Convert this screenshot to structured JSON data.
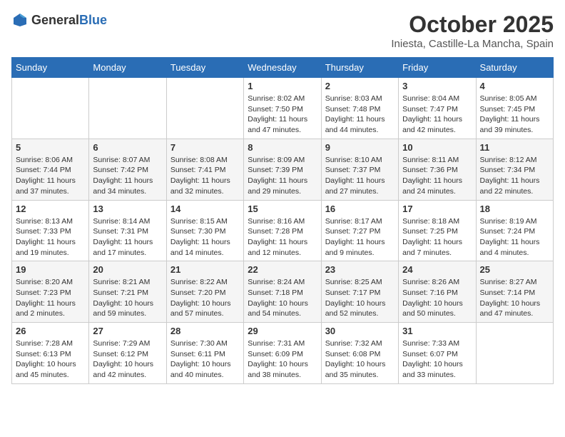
{
  "header": {
    "logo_general": "General",
    "logo_blue": "Blue",
    "month_title": "October 2025",
    "subtitle": "Iniesta, Castille-La Mancha, Spain"
  },
  "days_of_week": [
    "Sunday",
    "Monday",
    "Tuesday",
    "Wednesday",
    "Thursday",
    "Friday",
    "Saturday"
  ],
  "weeks": [
    [
      {
        "day": "",
        "sunrise": "",
        "sunset": "",
        "daylight": ""
      },
      {
        "day": "",
        "sunrise": "",
        "sunset": "",
        "daylight": ""
      },
      {
        "day": "",
        "sunrise": "",
        "sunset": "",
        "daylight": ""
      },
      {
        "day": "1",
        "sunrise": "Sunrise: 8:02 AM",
        "sunset": "Sunset: 7:50 PM",
        "daylight": "Daylight: 11 hours and 47 minutes."
      },
      {
        "day": "2",
        "sunrise": "Sunrise: 8:03 AM",
        "sunset": "Sunset: 7:48 PM",
        "daylight": "Daylight: 11 hours and 44 minutes."
      },
      {
        "day": "3",
        "sunrise": "Sunrise: 8:04 AM",
        "sunset": "Sunset: 7:47 PM",
        "daylight": "Daylight: 11 hours and 42 minutes."
      },
      {
        "day": "4",
        "sunrise": "Sunrise: 8:05 AM",
        "sunset": "Sunset: 7:45 PM",
        "daylight": "Daylight: 11 hours and 39 minutes."
      }
    ],
    [
      {
        "day": "5",
        "sunrise": "Sunrise: 8:06 AM",
        "sunset": "Sunset: 7:44 PM",
        "daylight": "Daylight: 11 hours and 37 minutes."
      },
      {
        "day": "6",
        "sunrise": "Sunrise: 8:07 AM",
        "sunset": "Sunset: 7:42 PM",
        "daylight": "Daylight: 11 hours and 34 minutes."
      },
      {
        "day": "7",
        "sunrise": "Sunrise: 8:08 AM",
        "sunset": "Sunset: 7:41 PM",
        "daylight": "Daylight: 11 hours and 32 minutes."
      },
      {
        "day": "8",
        "sunrise": "Sunrise: 8:09 AM",
        "sunset": "Sunset: 7:39 PM",
        "daylight": "Daylight: 11 hours and 29 minutes."
      },
      {
        "day": "9",
        "sunrise": "Sunrise: 8:10 AM",
        "sunset": "Sunset: 7:37 PM",
        "daylight": "Daylight: 11 hours and 27 minutes."
      },
      {
        "day": "10",
        "sunrise": "Sunrise: 8:11 AM",
        "sunset": "Sunset: 7:36 PM",
        "daylight": "Daylight: 11 hours and 24 minutes."
      },
      {
        "day": "11",
        "sunrise": "Sunrise: 8:12 AM",
        "sunset": "Sunset: 7:34 PM",
        "daylight": "Daylight: 11 hours and 22 minutes."
      }
    ],
    [
      {
        "day": "12",
        "sunrise": "Sunrise: 8:13 AM",
        "sunset": "Sunset: 7:33 PM",
        "daylight": "Daylight: 11 hours and 19 minutes."
      },
      {
        "day": "13",
        "sunrise": "Sunrise: 8:14 AM",
        "sunset": "Sunset: 7:31 PM",
        "daylight": "Daylight: 11 hours and 17 minutes."
      },
      {
        "day": "14",
        "sunrise": "Sunrise: 8:15 AM",
        "sunset": "Sunset: 7:30 PM",
        "daylight": "Daylight: 11 hours and 14 minutes."
      },
      {
        "day": "15",
        "sunrise": "Sunrise: 8:16 AM",
        "sunset": "Sunset: 7:28 PM",
        "daylight": "Daylight: 11 hours and 12 minutes."
      },
      {
        "day": "16",
        "sunrise": "Sunrise: 8:17 AM",
        "sunset": "Sunset: 7:27 PM",
        "daylight": "Daylight: 11 hours and 9 minutes."
      },
      {
        "day": "17",
        "sunrise": "Sunrise: 8:18 AM",
        "sunset": "Sunset: 7:25 PM",
        "daylight": "Daylight: 11 hours and 7 minutes."
      },
      {
        "day": "18",
        "sunrise": "Sunrise: 8:19 AM",
        "sunset": "Sunset: 7:24 PM",
        "daylight": "Daylight: 11 hours and 4 minutes."
      }
    ],
    [
      {
        "day": "19",
        "sunrise": "Sunrise: 8:20 AM",
        "sunset": "Sunset: 7:23 PM",
        "daylight": "Daylight: 11 hours and 2 minutes."
      },
      {
        "day": "20",
        "sunrise": "Sunrise: 8:21 AM",
        "sunset": "Sunset: 7:21 PM",
        "daylight": "Daylight: 10 hours and 59 minutes."
      },
      {
        "day": "21",
        "sunrise": "Sunrise: 8:22 AM",
        "sunset": "Sunset: 7:20 PM",
        "daylight": "Daylight: 10 hours and 57 minutes."
      },
      {
        "day": "22",
        "sunrise": "Sunrise: 8:24 AM",
        "sunset": "Sunset: 7:18 PM",
        "daylight": "Daylight: 10 hours and 54 minutes."
      },
      {
        "day": "23",
        "sunrise": "Sunrise: 8:25 AM",
        "sunset": "Sunset: 7:17 PM",
        "daylight": "Daylight: 10 hours and 52 minutes."
      },
      {
        "day": "24",
        "sunrise": "Sunrise: 8:26 AM",
        "sunset": "Sunset: 7:16 PM",
        "daylight": "Daylight: 10 hours and 50 minutes."
      },
      {
        "day": "25",
        "sunrise": "Sunrise: 8:27 AM",
        "sunset": "Sunset: 7:14 PM",
        "daylight": "Daylight: 10 hours and 47 minutes."
      }
    ],
    [
      {
        "day": "26",
        "sunrise": "Sunrise: 7:28 AM",
        "sunset": "Sunset: 6:13 PM",
        "daylight": "Daylight: 10 hours and 45 minutes."
      },
      {
        "day": "27",
        "sunrise": "Sunrise: 7:29 AM",
        "sunset": "Sunset: 6:12 PM",
        "daylight": "Daylight: 10 hours and 42 minutes."
      },
      {
        "day": "28",
        "sunrise": "Sunrise: 7:30 AM",
        "sunset": "Sunset: 6:11 PM",
        "daylight": "Daylight: 10 hours and 40 minutes."
      },
      {
        "day": "29",
        "sunrise": "Sunrise: 7:31 AM",
        "sunset": "Sunset: 6:09 PM",
        "daylight": "Daylight: 10 hours and 38 minutes."
      },
      {
        "day": "30",
        "sunrise": "Sunrise: 7:32 AM",
        "sunset": "Sunset: 6:08 PM",
        "daylight": "Daylight: 10 hours and 35 minutes."
      },
      {
        "day": "31",
        "sunrise": "Sunrise: 7:33 AM",
        "sunset": "Sunset: 6:07 PM",
        "daylight": "Daylight: 10 hours and 33 minutes."
      },
      {
        "day": "",
        "sunrise": "",
        "sunset": "",
        "daylight": ""
      }
    ]
  ]
}
